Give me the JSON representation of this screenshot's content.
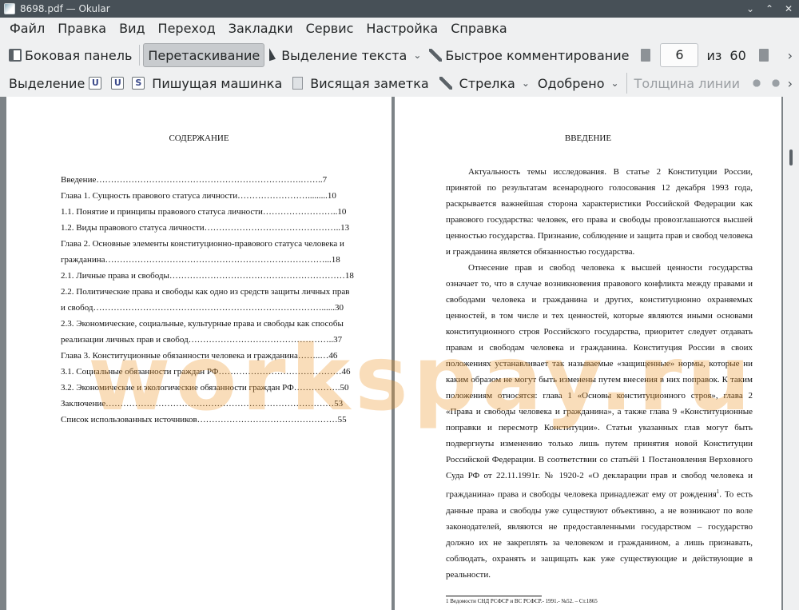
{
  "window": {
    "title": "8698.pdf — Okular"
  },
  "menubar": [
    "Файл",
    "Правка",
    "Вид",
    "Переход",
    "Закладки",
    "Сервис",
    "Настройка",
    "Справка"
  ],
  "toolbar1": {
    "sidebar_label": "Боковая панель",
    "drag_label": "Перетаскивание",
    "text_select_label": "Выделение текста",
    "quick_annot_label": "Быстрое комментирование",
    "page_current": "6",
    "page_of": "из",
    "page_total": "60"
  },
  "toolbar2": {
    "highlight_label": "Выделение",
    "typewriter_label": "Пишущая машинка",
    "note_label": "Висящая заметка",
    "arrow_label": "Стрелка",
    "stamp_label": "Одобрено",
    "line_width_label": "Толщина линии"
  },
  "left_page": {
    "heading": "СОДЕРЖАНИЕ",
    "toc": [
      "Введение…………………………………………………………….……..7",
      "Глава 1. Сущность правового статуса личности…………………….........10",
      "1.1. Понятие и принципы правового статуса личности……………………..10",
      "1.2. Виды правового статуса личности………………………………………..13",
      "Глава 2. Основные элементы конституционно-правового статуса человека и",
      "гражданина…………………………………………………………………...18",
      "2.1. Личные права и свободы……………………………………………………18",
      "2.2. Политические права и свободы как одно из средств защиты личных прав",
      "и свобод……………………………………………………………………......30",
      "2.3. Экономические, социальные, культурные права и свободы как способы",
      "реализации личных прав и свобод…………………………………………..37",
      "Глава 3. Конституционные обязанности человека и гражданина……..…46",
      "3.1. Социальные обязанности граждан РФ……………………………………46",
      "3.2. Экономические и экологические обязанности граждан РФ…………….50",
      "Заключение……………………………………………………………………53",
      "Список использованных источников…………………………………………55"
    ]
  },
  "right_page": {
    "heading": "ВВЕДЕНИЕ",
    "p1": "Актуальность темы исследования. В статье 2 Конституции России, принятой по результатам всенародного голосования 12 декабря 1993 года, раскрывается важнейшая сторона характеристики Российской Федерации как правового государства: человек, его права и свободы провозглашаются высшей ценностью государства. Признание, соблюдение и защита прав и свобод человека и гражданина является обязанностью государства.",
    "p2a": "Отнесение прав и свобод человека к высшей ценности государства означает то, что в случае возникновения правового конфликта между правами и свободами человека и гражданина и других, конституционно охраняемых ценностей, в том числе и тех ценностей, которые являются иными основами конституционного строя Российского государства, приоритет следует отдавать правам и свободам человека и гражданина. Конституция России в своих положениях устанавливает так называемые «защищенные» нормы, которые ни каким образом не могут быть изменены путем внесения в них поправок. К таким положениям относятся: глава 1 «Основы конституционного строя», глава 2 «Права и свободы человека и гражданина», а также глава 9 «Конституционные поправки и пересмотр Конституции». Статьи указанных глав могут быть подвергнуты изменению только лишь путем принятия новой Конституции Российской Федерации. В соответствии со статьёй 1 Постановления Верховного Суда РФ от 22.11.1991г. № 1920-2 «О декларации прав и свобод человека и гражданина» права и свободы человека принадлежат ему от рождения",
    "fn_mark": "1",
    "p2b": ". То есть данные права и свободы уже существуют объективно, а не возникают по воле законодателей, являются не предоставленными государством – государство должно их не закреплять за человеком и гражданином, а лишь признавать, соблюдать, охранять и защищать как уже существующие и действующие в реальности.",
    "footnote": "1 Ведомости СНД РСФСР и ВС РСФСР.- 1991.- №52. – Ст.1865"
  },
  "watermark": "workspay.ru"
}
